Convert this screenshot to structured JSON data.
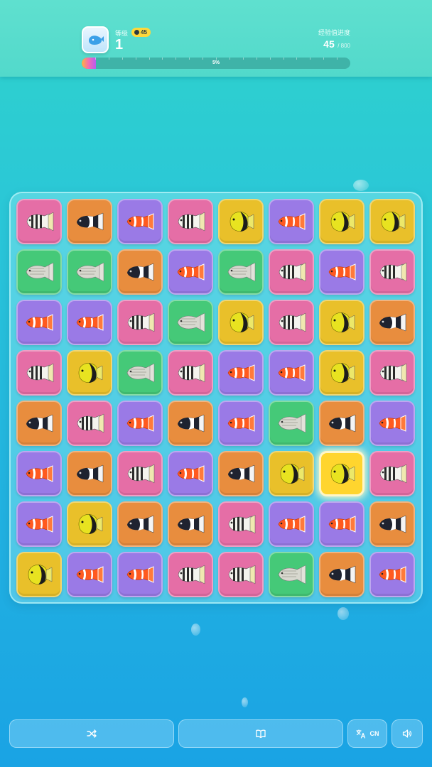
{
  "header": {
    "level_label": "等级",
    "level_badge": "45",
    "level_value": "1",
    "xp_label": "经验值进度",
    "xp_current": "45",
    "xp_max": "/ 800",
    "progress_text": "5%",
    "progress_fraction": 0.05
  },
  "toolbar": {
    "shuffle_icon": "shuffle-icon",
    "guide_icon": "book-icon",
    "language_label": "CN",
    "language_icon": "translate-icon",
    "sound_icon": "speaker-icon"
  },
  "board": {
    "rows": 8,
    "cols": 8,
    "selected": [
      5,
      6
    ],
    "tile_types": {
      "S": {
        "name": "striped-butterflyfish",
        "bg": "#e56ea6"
      },
      "C": {
        "name": "clownfish",
        "bg": "#9a7ae6"
      },
      "D": {
        "name": "domino-damselfish",
        "bg": "#e88d3e"
      },
      "Y": {
        "name": "yellow-angelfish",
        "bg": "#e9c02a"
      },
      "G": {
        "name": "grey-seabream",
        "bg": "#45c978"
      }
    },
    "grid": [
      [
        "S",
        "D",
        "C",
        "S",
        "Y",
        "C",
        "Y",
        "Y"
      ],
      [
        "G",
        "G",
        "D",
        "C",
        "G",
        "S",
        "C",
        "S"
      ],
      [
        "C",
        "C",
        "S",
        "G",
        "Y",
        "S",
        "Y",
        "D"
      ],
      [
        "S",
        "Y",
        "G",
        "S",
        "C",
        "C",
        "Y",
        "S"
      ],
      [
        "D",
        "S",
        "C",
        "D",
        "C",
        "G",
        "D",
        "C"
      ],
      [
        "C",
        "D",
        "S",
        "C",
        "D",
        "Y",
        "Y",
        "S"
      ],
      [
        "C",
        "Y",
        "D",
        "D",
        "S",
        "C",
        "C",
        "D"
      ],
      [
        "Y",
        "C",
        "C",
        "S",
        "S",
        "G",
        "D",
        "C"
      ]
    ]
  }
}
